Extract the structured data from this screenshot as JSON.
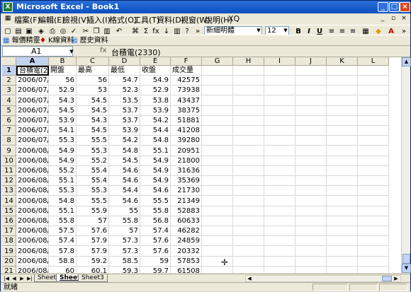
{
  "window": {
    "title": "Microsoft Excel - Book1",
    "app_icon": "excel-icon"
  },
  "menu": [
    "檔案(F)",
    "編輯(E)",
    "檢視(V)",
    "插入(I)",
    "格式(O)",
    "工具(T)",
    "資料(D)",
    "視窗(W)",
    "說明(H)",
    "XQ"
  ],
  "toolbar": {
    "font_name": "新細明體",
    "font_size": "12",
    "bold": "B",
    "italic": "I",
    "underline": "U",
    "sigma": "Σ",
    "fx": "fx",
    "percent": "%"
  },
  "custom_toolbar": {
    "buttons": [
      "報價精靈",
      "K線資料",
      "歷史資料"
    ]
  },
  "formula_bar": {
    "name_box": "A1",
    "fx_label": "fx",
    "formula": "台積電(2330)"
  },
  "columns": [
    "A",
    "B",
    "C",
    "D",
    "E",
    "F",
    "G",
    "H",
    "I",
    "J",
    "K",
    "L"
  ],
  "rows": [
    {
      "n": "1",
      "a": "台積電(23",
      "b": "開盤",
      "c": "最高",
      "d": "最低",
      "e": "收盤",
      "f": "成交量"
    },
    {
      "n": "2",
      "a": "2006/07/21",
      "b": "56",
      "c": "56",
      "d": "54.7",
      "e": "54.9",
      "f": "42575"
    },
    {
      "n": "3",
      "a": "2006/07/24",
      "b": "52.9",
      "c": "53",
      "d": "52.3",
      "e": "52.9",
      "f": "73938"
    },
    {
      "n": "4",
      "a": "2006/07/25",
      "b": "54.3",
      "c": "54.5",
      "d": "53.5",
      "e": "53.8",
      "f": "43437"
    },
    {
      "n": "5",
      "a": "2006/07/26",
      "b": "54.5",
      "c": "54.5",
      "d": "53.7",
      "e": "53.9",
      "f": "38375"
    },
    {
      "n": "6",
      "a": "2006/07/27",
      "b": "53.9",
      "c": "54.3",
      "d": "53.7",
      "e": "54.2",
      "f": "51881"
    },
    {
      "n": "7",
      "a": "2006/07/28",
      "b": "54.1",
      "c": "54.5",
      "d": "53.9",
      "e": "54.4",
      "f": "41208"
    },
    {
      "n": "8",
      "a": "2006/07/31",
      "b": "55.3",
      "c": "55.5",
      "d": "54.2",
      "e": "54.8",
      "f": "39280"
    },
    {
      "n": "9",
      "a": "2006/08/01",
      "b": "54.9",
      "c": "55.3",
      "d": "54.8",
      "e": "55.1",
      "f": "20951"
    },
    {
      "n": "10",
      "a": "2006/08/02",
      "b": "54.9",
      "c": "55.2",
      "d": "54.5",
      "e": "54.9",
      "f": "21800"
    },
    {
      "n": "11",
      "a": "2006/08/03",
      "b": "55.2",
      "c": "55.4",
      "d": "54.6",
      "e": "54.9",
      "f": "31636"
    },
    {
      "n": "12",
      "a": "2006/08/04",
      "b": "55.1",
      "c": "55.4",
      "d": "54.6",
      "e": "54.9",
      "f": "35369"
    },
    {
      "n": "13",
      "a": "2006/08/07",
      "b": "55.3",
      "c": "55.3",
      "d": "54.4",
      "e": "54.6",
      "f": "21730"
    },
    {
      "n": "14",
      "a": "2006/08/08",
      "b": "54.8",
      "c": "55.5",
      "d": "54.6",
      "e": "55.5",
      "f": "21349"
    },
    {
      "n": "15",
      "a": "2006/08/09",
      "b": "55.1",
      "c": "55.9",
      "d": "55",
      "e": "55.8",
      "f": "52883"
    },
    {
      "n": "16",
      "a": "2006/08/10",
      "b": "55.8",
      "c": "57",
      "d": "55.8",
      "e": "56.8",
      "f": "60633"
    },
    {
      "n": "17",
      "a": "2006/08/11",
      "b": "57.5",
      "c": "57.6",
      "d": "57",
      "e": "57.4",
      "f": "46282"
    },
    {
      "n": "18",
      "a": "2006/08/14",
      "b": "57.4",
      "c": "57.9",
      "d": "57.3",
      "e": "57.6",
      "f": "24859"
    },
    {
      "n": "19",
      "a": "2006/08/15",
      "b": "57.8",
      "c": "57.9",
      "d": "57.3",
      "e": "57.6",
      "f": "20332"
    },
    {
      "n": "20",
      "a": "2006/08/16",
      "b": "58.8",
      "c": "59.2",
      "d": "58.5",
      "e": "59",
      "f": "57853"
    },
    {
      "n": "21",
      "a": "2006/08/17",
      "b": "60",
      "c": "60.1",
      "d": "59.3",
      "e": "59.7",
      "f": "61508"
    },
    {
      "n": "22",
      "a": "",
      "b": "",
      "c": "",
      "d": "",
      "e": "",
      "f": ""
    }
  ],
  "sheets": [
    "Sheet1",
    "Sheet2",
    "Sheet3"
  ],
  "active_sheet": "Sheet2",
  "status": {
    "text": "就緒"
  },
  "colors": {
    "title_bar": "#0a4fc0",
    "selection_header": "#c2d3f0"
  }
}
